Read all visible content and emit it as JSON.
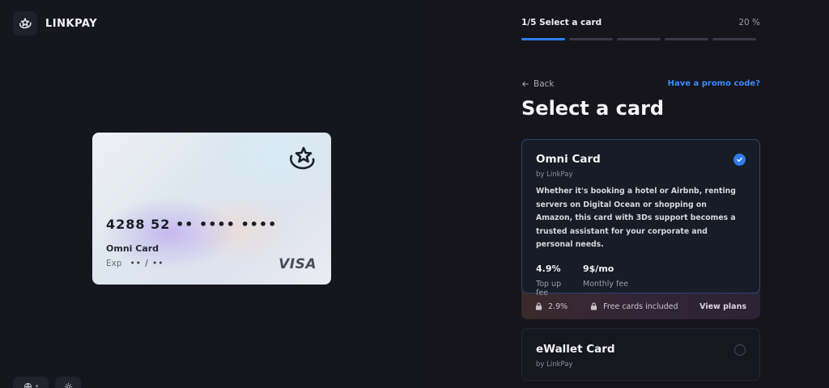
{
  "brand": {
    "name": "LINKPAY",
    "logo_icon": "linkpay-logo-icon"
  },
  "card_preview": {
    "number": "4288 52 •• •••• ••••",
    "name": "Omni Card",
    "exp_label": "Exp",
    "exp_value": "•• / ••",
    "network": "VISA"
  },
  "steps": {
    "label": "1/5 Select a card",
    "percent": "20 %",
    "total": 5,
    "current": 1
  },
  "nav": {
    "back_label": "Back",
    "promo_label": "Have a promo code?"
  },
  "page_title": "Select a card",
  "options": [
    {
      "name": "Omni Card",
      "by": "by LinkPay",
      "selected": true,
      "description": "Whether it's booking a hotel or Airbnb, renting servers on Digital Ocean or shopping on Amazon, this card with 3Ds support becomes a trusted assistant for your corporate and personal needs.",
      "stats": [
        {
          "value": "4.9%",
          "label": "Top up fee"
        },
        {
          "value": "9$/mo",
          "label": "Monthly fee"
        }
      ],
      "footer": {
        "rate": "2.9%",
        "free_cards": "Free cards included",
        "view_plans": "View plans"
      }
    },
    {
      "name": "eWallet Card",
      "by": "by LinkPay",
      "selected": false
    }
  ],
  "colors": {
    "accent": "#2f7dec",
    "promo": "#3a8cff",
    "background": "#15151b"
  }
}
